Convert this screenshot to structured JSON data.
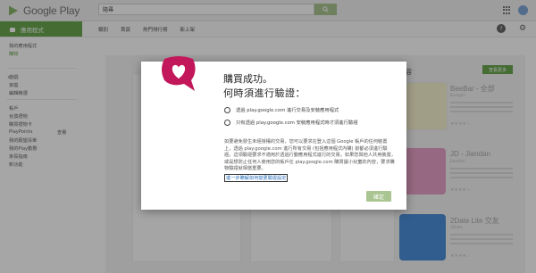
{
  "topbar": {
    "logo_text": "Google Play",
    "search": {
      "value": "隨尋",
      "placeholder": ""
    }
  },
  "subbar": {
    "section_label": "應用程式",
    "nav": [
      "類別",
      "首頁",
      "熱門排行榜",
      "新上架"
    ]
  },
  "sidebar": {
    "items": [
      "我的應用程式",
      "購物",
      "",
      "遊戲",
      "家庭",
      "編輯精選",
      "帳戶",
      "兌換禮物",
      "購買禮物卡",
      "PlayPoints",
      "我的願望清單",
      "我的Play動態",
      "家長指南",
      "新功能"
    ],
    "playpoints_badge": "查看"
  },
  "right_col": {
    "header": "內容",
    "button": "查看更多",
    "cards": [
      {
        "title": "BeeBar - 全部",
        "subtitle": "Kurogiri",
        "color": "#f4f0c8"
      },
      {
        "title": "JD - Jiandan",
        "subtitle": "Jiandan",
        "color": "#e8a0c8"
      },
      {
        "title": "2Date Lite 交友",
        "subtitle": "2Date",
        "color": "#ffffff"
      }
    ]
  },
  "dialog": {
    "title_line1": "購買成功。",
    "title_line2": "何時須進行驗證：",
    "options": [
      "透過 play.google.com 進行交易及安裝應用程式",
      "只有透過 play.google.com 安裝應用程式時才須進行驗證"
    ],
    "description": "如要避免發生未經授權的交易，您可以要求在登入這個 Google 帳戶的任何裝置上，透過 play.google.com 進行所有交易 (包括應用程式內購) 前都必須進行驗證。這項驗證要求不適用於透過行動應用程式進行的交易。如果您與他人共用裝置，或是想防止任何人使用您的帳戶在 play.google.com 購買讓小兒童的內容，要求購物驗證就相當重要。",
    "help_link": "進一步瞭解如何變更驗證設定",
    "ok_label": "確定"
  },
  "colors": {
    "play_green": "#6aa84f",
    "badge_pink": "#c2185b",
    "overlay": "#000000"
  }
}
